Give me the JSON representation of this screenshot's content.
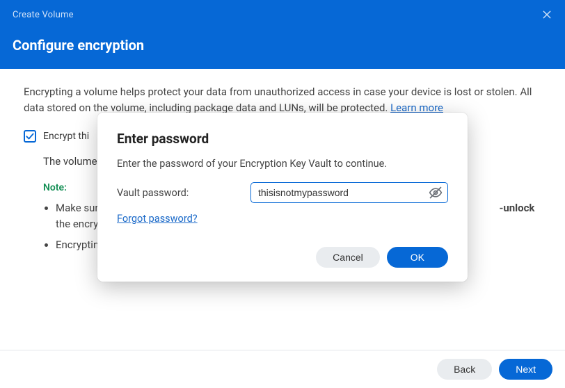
{
  "header": {
    "title": "Create Volume",
    "subtitle": "Configure encryption"
  },
  "desc": {
    "text": "Encrypting a volume helps protect your data from unauthorized access in case your device is lost or stolen. All data stored on the volume, including package data and LUNs, will be protected. ",
    "learn_more": "Learn more"
  },
  "encrypt": {
    "checkbox_label": "Encrypt thi",
    "sub_text": "The volume"
  },
  "note": {
    "label": "Note:",
    "items": [
      {
        "pre": "Make sur",
        "bold": "-unlock",
        "post": " the encrypte"
      },
      {
        "pre": "Encryptin",
        "bold": "",
        "post": ""
      }
    ]
  },
  "footer": {
    "back": "Back",
    "next": "Next"
  },
  "modal": {
    "title": "Enter password",
    "desc": "Enter the password of your Encryption Key Vault to continue.",
    "field_label": "Vault password:",
    "password_value": "thisisnotmypassword",
    "forgot": "Forgot password?",
    "cancel": "Cancel",
    "ok": "OK"
  }
}
